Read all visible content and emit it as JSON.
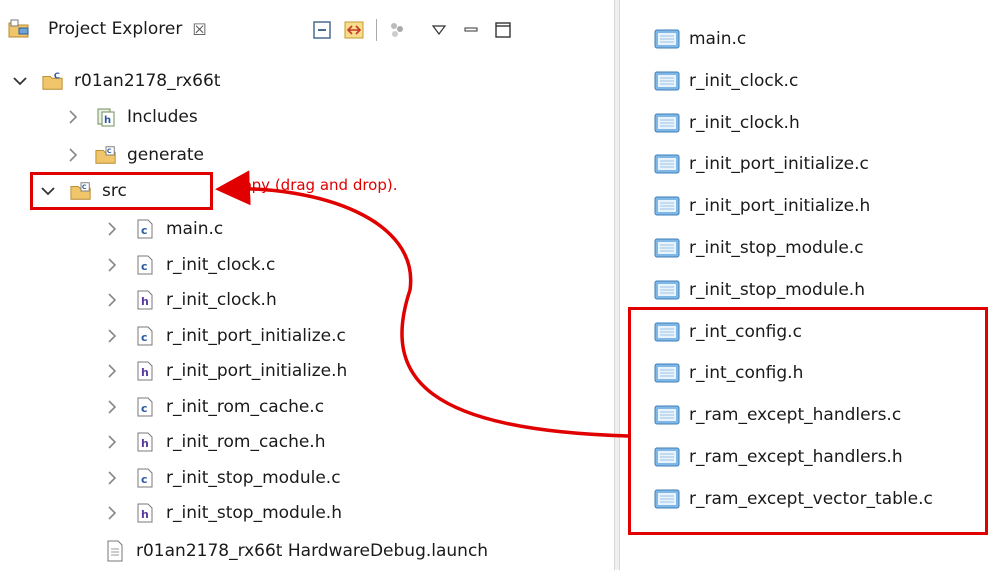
{
  "explorer": {
    "title": "Project Explorer",
    "close_glyph": "☒",
    "toolbar": [
      "collapse-all-icon",
      "link-with-editor-icon",
      "filter-icon",
      "view-menu-icon",
      "minimize-icon",
      "maximize-icon"
    ],
    "project": "r01an2178_rx66t",
    "nodes": {
      "includes": "Includes",
      "generate": "generate",
      "src": "src"
    },
    "src_files": [
      {
        "name": "main.c",
        "type": "c"
      },
      {
        "name": "r_init_clock.c",
        "type": "c"
      },
      {
        "name": "r_init_clock.h",
        "type": "h"
      },
      {
        "name": "r_init_port_initialize.c",
        "type": "c"
      },
      {
        "name": "r_init_port_initialize.h",
        "type": "h"
      },
      {
        "name": "r_init_rom_cache.c",
        "type": "c"
      },
      {
        "name": "r_init_rom_cache.h",
        "type": "h"
      },
      {
        "name": "r_init_stop_module.c",
        "type": "c"
      },
      {
        "name": "r_init_stop_module.h",
        "type": "h"
      }
    ],
    "launch_file": "r01an2178_rx66t HardwareDebug.launch"
  },
  "annotation": {
    "text": "Copy (drag and drop).",
    "color": "#e00000"
  },
  "file_list": [
    "main.c",
    "r_init_clock.c",
    "r_init_clock.h",
    "r_init_port_initialize.c",
    "r_init_port_initialize.h",
    "r_init_stop_module.c",
    "r_init_stop_module.h",
    "r_int_config.c",
    "r_int_config.h",
    "r_ram_except_handlers.c",
    "r_ram_except_handlers.h",
    "r_ram_except_vector_table.c"
  ]
}
